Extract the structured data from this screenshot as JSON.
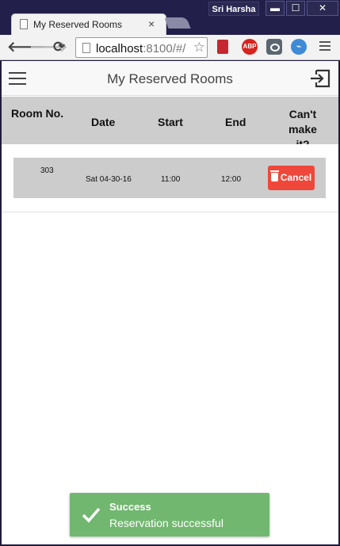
{
  "browser": {
    "user": "Sri Harsha",
    "window_controls": {
      "minimize": "▬",
      "maximize": "☐",
      "close": "✕"
    },
    "tab_title": "My Reserved Rooms",
    "tab_close": "×",
    "url_host": "localhost",
    "url_rest": ":8100/#/",
    "extensions": {
      "abp": "ABP",
      "pulse": "⌁"
    },
    "nav": {
      "back": "🡐",
      "forward": "🡒",
      "reload": "⟳",
      "star": "☆"
    }
  },
  "app": {
    "title": "My Reserved Rooms",
    "columns": {
      "room": "Room No.",
      "date": "Date",
      "start": "Start",
      "end": "End",
      "cancel_line1": "Can't",
      "cancel_line2": "make it?"
    },
    "reservations": [
      {
        "room": "303",
        "date": "Sat 04-30-16",
        "start": "11:00",
        "end": "12:00",
        "action": "Cancel"
      }
    ],
    "colors": {
      "cancel": "#ef473a",
      "toast": "#72b770",
      "header_bg": "#cdcdcd"
    }
  },
  "toast": {
    "title": "Success",
    "message": "Reservation successful"
  }
}
